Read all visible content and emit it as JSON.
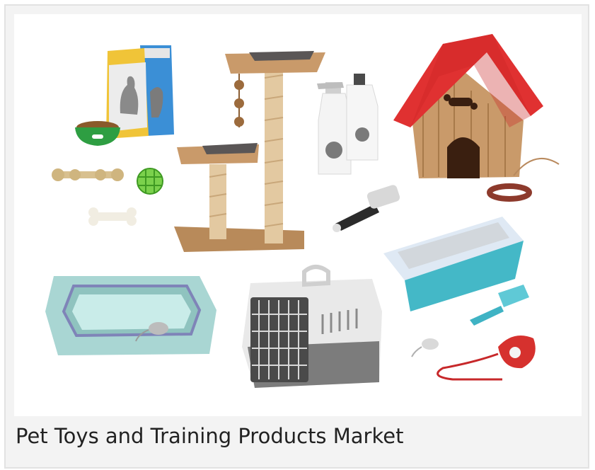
{
  "caption": "Pet Toys and Training Products Market",
  "figure": {
    "items": [
      "pet-food-bags",
      "food-bowl",
      "rope-toy",
      "ball-toy",
      "bone-toy",
      "cat-tree",
      "spray-bottle",
      "detergent-bottle",
      "grooming-brush",
      "dog-house",
      "collar",
      "pet-bed",
      "toy-mouse",
      "pet-carrier",
      "litter-box",
      "litter-scoop",
      "retractable-leash"
    ]
  },
  "colors": {
    "card_background": "#f3f3f3",
    "card_border": "#e2e2e2",
    "caption_text": "#222222",
    "roof_red": "#e03131",
    "wood": "#c99a6a",
    "teal": "#44b8c7",
    "bed_mint": "#b9e0df"
  }
}
